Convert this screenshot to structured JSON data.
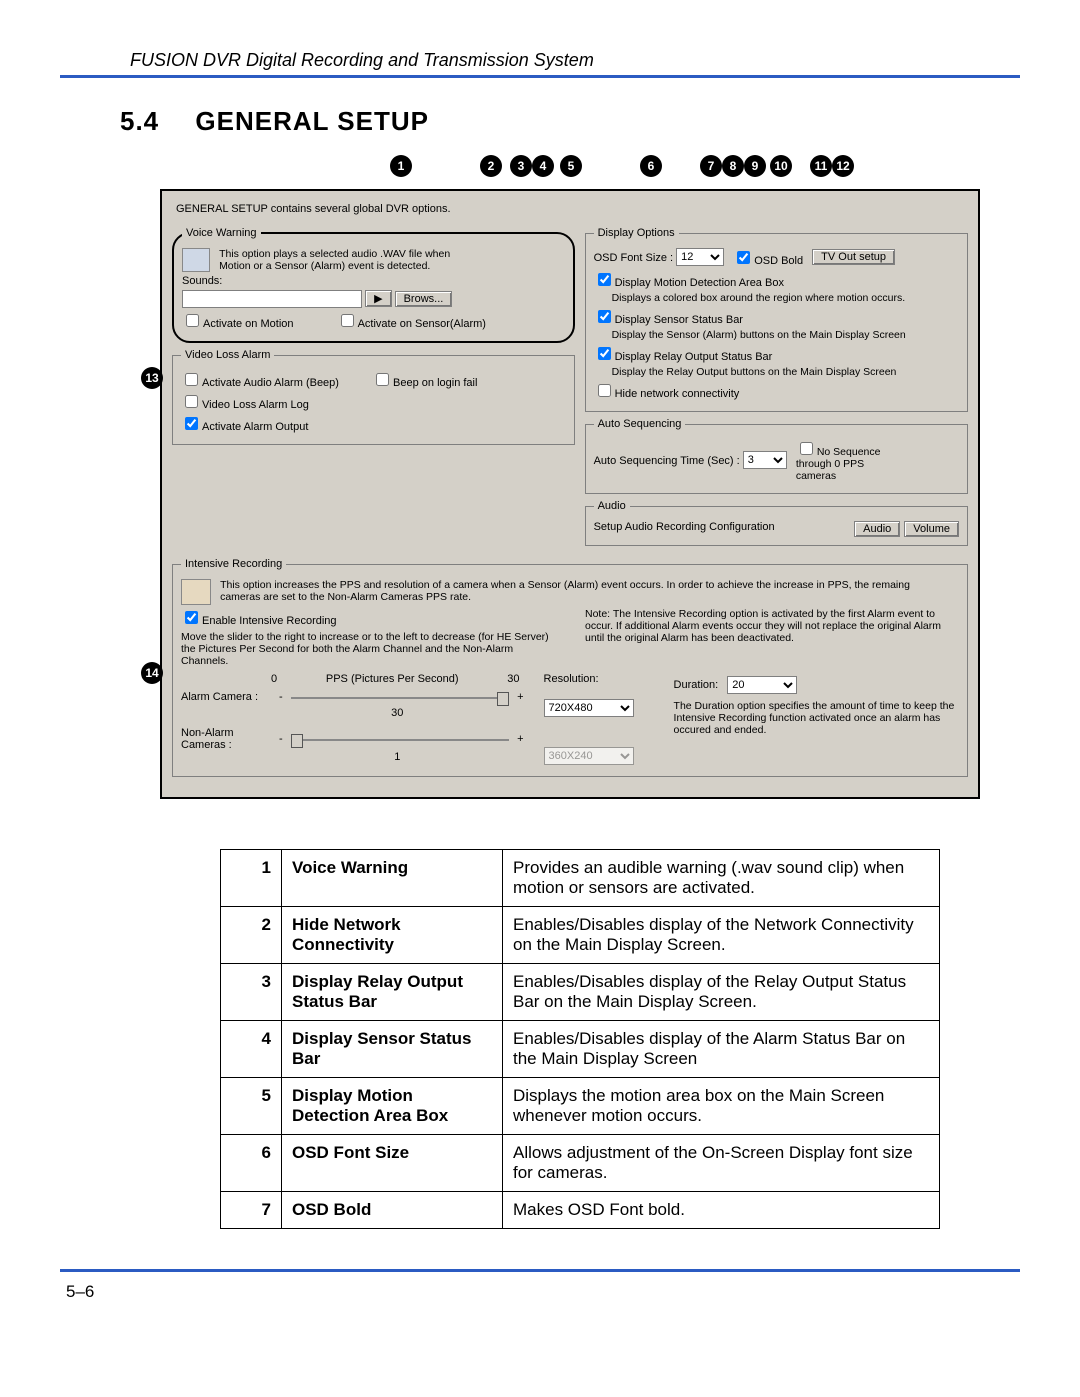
{
  "header": "FUSION DVR Digital Recording and Transmission System",
  "section": {
    "number": "5.4",
    "title": "GENERAL SETUP"
  },
  "callouts": [
    "1",
    "2",
    "3",
    "4",
    "5",
    "6",
    "7",
    "8",
    "9",
    "10",
    "11",
    "12"
  ],
  "side_callouts": {
    "c13": "13",
    "c14": "14"
  },
  "panel": {
    "intro": "GENERAL SETUP contains several global DVR options.",
    "voice": {
      "legend": "Voice Warning",
      "desc": "This option plays a selected audio .WAV file when Motion or a Sensor (Alarm) event is detected.",
      "sounds_label": "Sounds:",
      "sounds_value": "",
      "play": "▶",
      "browse": "Brows...",
      "activate_motion": "Activate on Motion",
      "activate_sensor": "Activate on Sensor(Alarm)"
    },
    "vloss": {
      "legend": "Video Loss Alarm",
      "audio_alarm": "Activate Audio Alarm (Beep)",
      "beep_login": "Beep on login fail",
      "video_loss_log": "Video Loss Alarm Log",
      "activate_output": "Activate Alarm Output"
    },
    "display": {
      "legend": "Display Options",
      "osd_font_label": "OSD Font Size :",
      "osd_font_value": "12",
      "osd_bold": "OSD Bold",
      "tv_out": "TV Out setup",
      "motion_box": "Display Motion Detection Area Box",
      "motion_box_desc": "Displays a colored box around the region where motion occurs.",
      "sensor_bar": "Display Sensor Status Bar",
      "sensor_bar_desc": "Display the Sensor (Alarm) buttons on the Main Display Screen",
      "relay_bar": "Display Relay Output Status Bar",
      "relay_bar_desc": "Display the Relay Output buttons on the Main Display Screen",
      "hide_net": "Hide network connectivity"
    },
    "autoseq": {
      "legend": "Auto Sequencing",
      "time_label": "Auto Sequencing Time (Sec) :",
      "time_value": "3",
      "noseq": "No Sequence through 0 PPS cameras"
    },
    "audio": {
      "legend": "Audio",
      "desc": "Setup Audio Recording Configuration",
      "btn_audio": "Audio",
      "btn_volume": "Volume"
    },
    "intensive": {
      "legend": "Intensive Recording",
      "desc": "This option increases the PPS and resolution of a camera when a Sensor (Alarm) event occurs. In order to achieve the increase in PPS, the remaing cameras are set to the Non-Alarm Cameras PPS rate.",
      "enable": "Enable Intensive Recording",
      "slider_help": "Move the slider to the right to increase or to the left to decrease (for HE Server) the Pictures Per Second for both the Alarm Channel and the Non-Alarm Channels.",
      "note": "Note: The Intensive Recording option is activated by the first Alarm event to occur. If additional Alarm events occur they will not replace the original Alarm until the original Alarm has been deactivated.",
      "scale_left": "0",
      "scale_label": "PPS (Pictures Per Second)",
      "scale_right": "30",
      "res_label": "Resolution:",
      "alarm_cam_label": "Alarm Camera :",
      "alarm_cam_value": "30",
      "alarm_res": "720X480",
      "duration_label": "Duration:",
      "duration_value": "20",
      "duration_desc": "The Duration option specifies the amount of time to keep the Intensive Recording function activated once an alarm has occured and ended.",
      "nonalarm_label": "Non-Alarm Cameras :",
      "nonalarm_value": "1",
      "nonalarm_res": "360X240"
    }
  },
  "table": [
    {
      "n": "1",
      "term": "Voice Warning",
      "desc": "Provides an audible warning (.wav sound clip) when motion or sensors are activated."
    },
    {
      "n": "2",
      "term": "Hide Network Connectivity",
      "desc": "Enables/Disables display of the Network Connectivity on the Main Display Screen."
    },
    {
      "n": "3",
      "term": "Display Relay Output Status Bar",
      "desc": "Enables/Disables display of the Relay Output Status Bar on the Main Display Screen."
    },
    {
      "n": "4",
      "term": "Display Sensor Status Bar",
      "desc": "Enables/Disables display of the Alarm Status Bar on the Main Display Screen"
    },
    {
      "n": "5",
      "term": "Display Motion Detection Area Box",
      "desc": "Displays the motion area box on the Main Screen whenever motion occurs."
    },
    {
      "n": "6",
      "term": "OSD Font Size",
      "desc": "Allows adjustment of the On-Screen Display font size for cameras."
    },
    {
      "n": "7",
      "term": "OSD Bold",
      "desc": "Makes OSD Font bold."
    }
  ],
  "page_number": "5–6"
}
